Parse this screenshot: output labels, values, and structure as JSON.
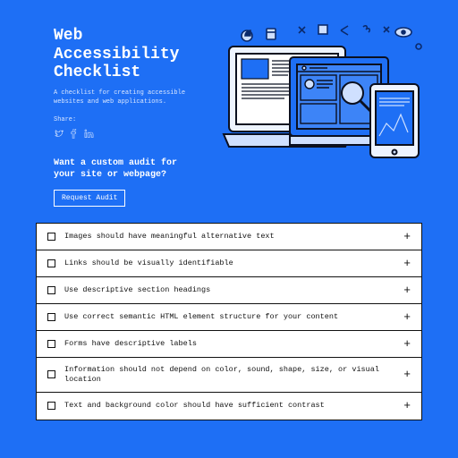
{
  "hero": {
    "title_l1": "Web",
    "title_l2": "Accessibility",
    "title_l3": "Checklist",
    "subtitle": "A checklist for creating accessible websites and web applications.",
    "share_label": "Share:",
    "audit_text": "Want a custom audit for your site or webpage?",
    "audit_button": "Request Audit"
  },
  "checklist": [
    {
      "text": "Images should have meaningful alternative text"
    },
    {
      "text": "Links should be visually identifiable"
    },
    {
      "text": "Use descriptive section headings"
    },
    {
      "text": "Use correct semantic HTML element structure for your content"
    },
    {
      "text": "Forms have descriptive labels"
    },
    {
      "text": "Information should not depend on color, sound, shape, size, or visual location"
    },
    {
      "text": "Text and background color should have sufficient contrast"
    }
  ]
}
